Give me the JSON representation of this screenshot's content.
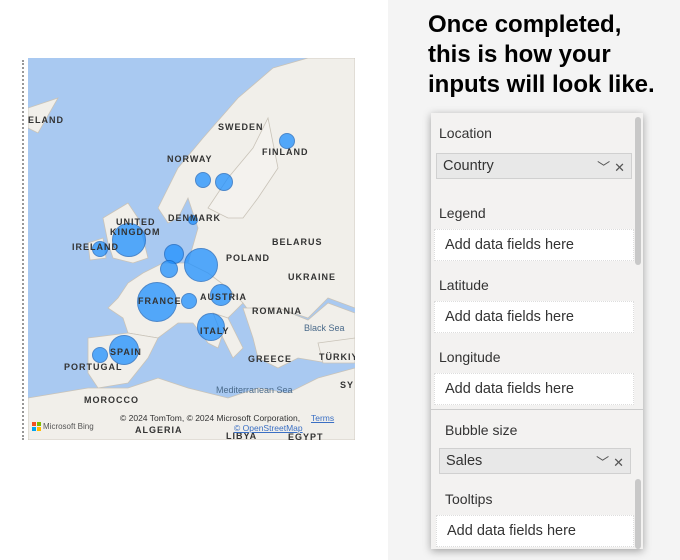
{
  "heading": {
    "line1": "Once completed,",
    "line2": "this is how your",
    "line3": "inputs will look like."
  },
  "map": {
    "labels": {
      "iceland": "ELAND",
      "sweden": "SWEDEN",
      "norway": "NORWAY",
      "finland": "FINLAND",
      "denmark": "DENMARK",
      "uk1": "UNITED",
      "uk2": "KINGDOM",
      "ireland": "IRELAND",
      "belarus": "BELARUS",
      "poland": "POLAND",
      "ukraine": "UKRAINE",
      "france": "FRANCE",
      "austria": "AUSTRIA",
      "romania": "ROMANIA",
      "black_sea": "Black Sea",
      "italy": "ITALY",
      "spain": "SPAIN",
      "portugal": "PORTUGAL",
      "greece": "GREECE",
      "turkiye": "TÜRKIY",
      "med_sea": "Mediterranean Sea",
      "syria": "SY",
      "morocco": "MOROCCO",
      "algeria": "ALGERIA",
      "libya": "LIBYA",
      "egypt": "EGYPT"
    },
    "attribution": "© 2024 TomTom, © 2024 Microsoft Corporation,",
    "terms": "Terms",
    "osm": "© OpenStreetMap",
    "bing": "Microsoft Bing",
    "bubble_color": "#1e90ff",
    "bubbles": [
      "Finland",
      "Norway",
      "Sweden",
      "Denmark",
      "United Kingdom",
      "Ireland",
      "Netherlands",
      "Belgium",
      "Germany",
      "France",
      "Switzerland",
      "Austria",
      "Italy",
      "Spain",
      "Portugal"
    ]
  },
  "panel": {
    "location": {
      "label": "Location",
      "value": "Country"
    },
    "legend": {
      "label": "Legend",
      "placeholder": "Add data fields here"
    },
    "latitude": {
      "label": "Latitude",
      "placeholder": "Add data fields here"
    },
    "longitude": {
      "label": "Longitude",
      "placeholder": "Add data fields here"
    },
    "bubble_size": {
      "label": "Bubble size",
      "value": "Sales"
    },
    "tooltips": {
      "label": "Tooltips",
      "placeholder": "Add data fields here"
    }
  }
}
